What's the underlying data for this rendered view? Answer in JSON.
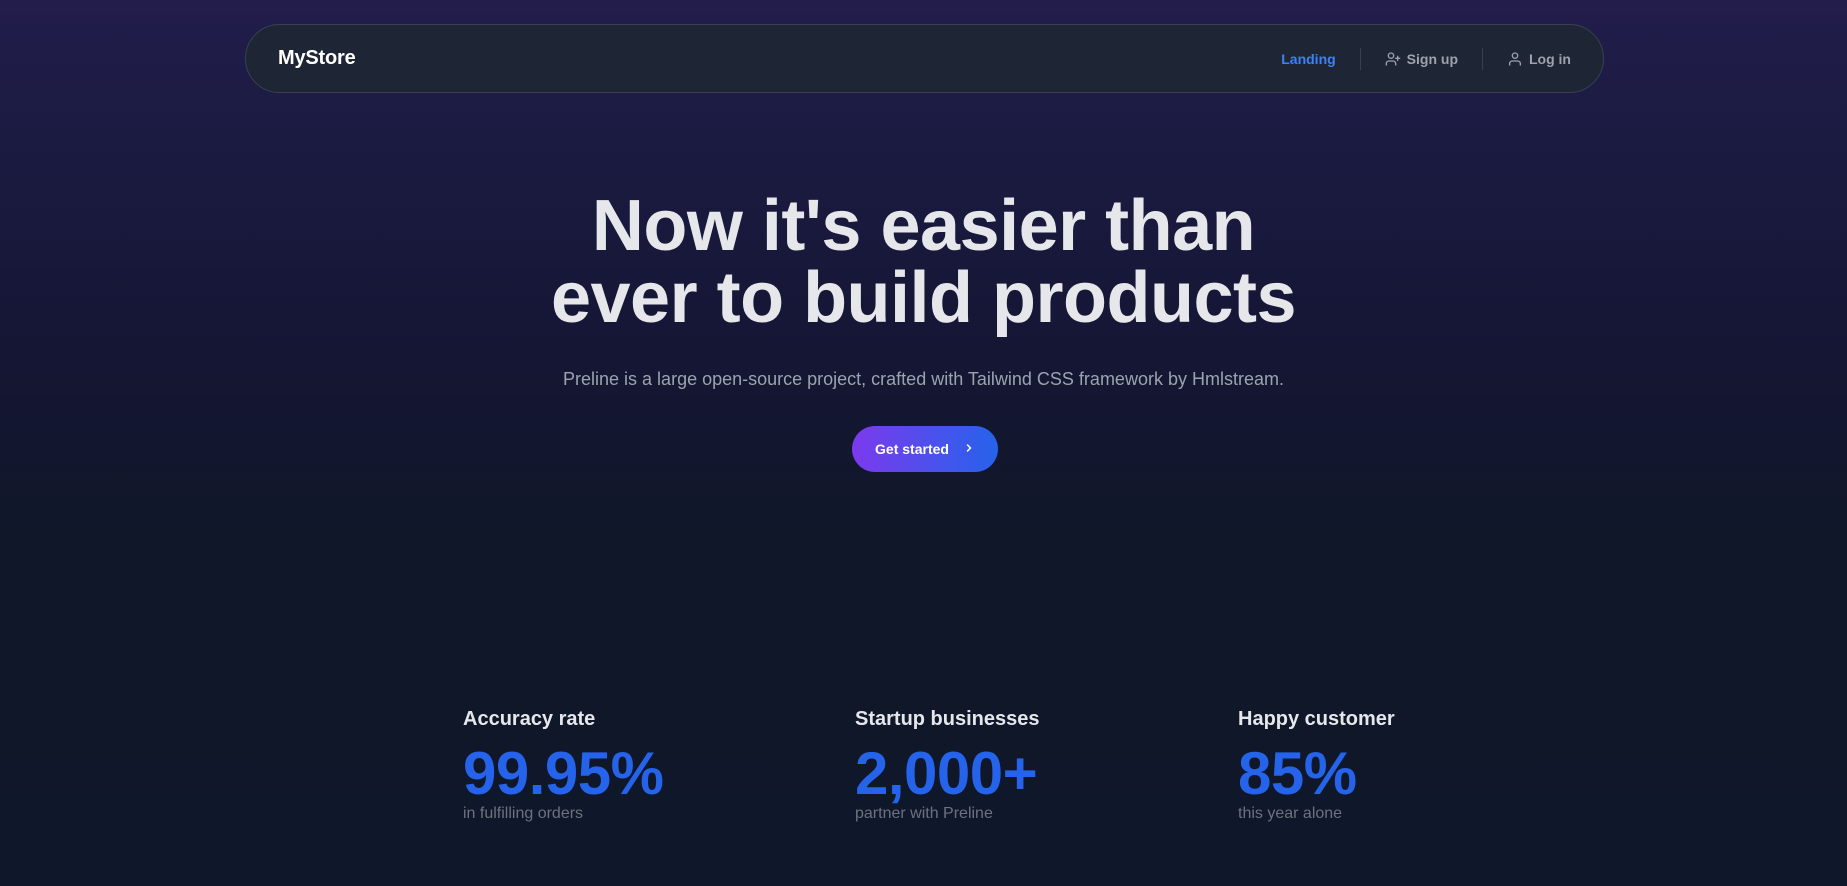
{
  "navbar": {
    "brand": "MyStore",
    "links": [
      {
        "label": "Landing",
        "active": true,
        "icon": null
      },
      {
        "label": "Sign up",
        "active": false,
        "icon": "user-plus-icon"
      },
      {
        "label": "Log in",
        "active": false,
        "icon": "user-icon"
      }
    ]
  },
  "hero": {
    "title_line1": "Now it's easier than",
    "title_line2": "ever to build products",
    "subtitle": "Preline is a large open-source project, crafted with Tailwind CSS framework by Hmlstream.",
    "cta_label": "Get started"
  },
  "stats": [
    {
      "label": "Accuracy rate",
      "value": "99.95%",
      "desc": "in fulfilling orders"
    },
    {
      "label": "Startup businesses",
      "value": "2,000+",
      "desc": "partner with Preline"
    },
    {
      "label": "Happy customer",
      "value": "85%",
      "desc": "this year alone"
    }
  ],
  "colors": {
    "accent": "#2563eb",
    "active_link": "#3b82f6",
    "gradient_start": "#7c3aed",
    "gradient_end": "#2563eb"
  }
}
